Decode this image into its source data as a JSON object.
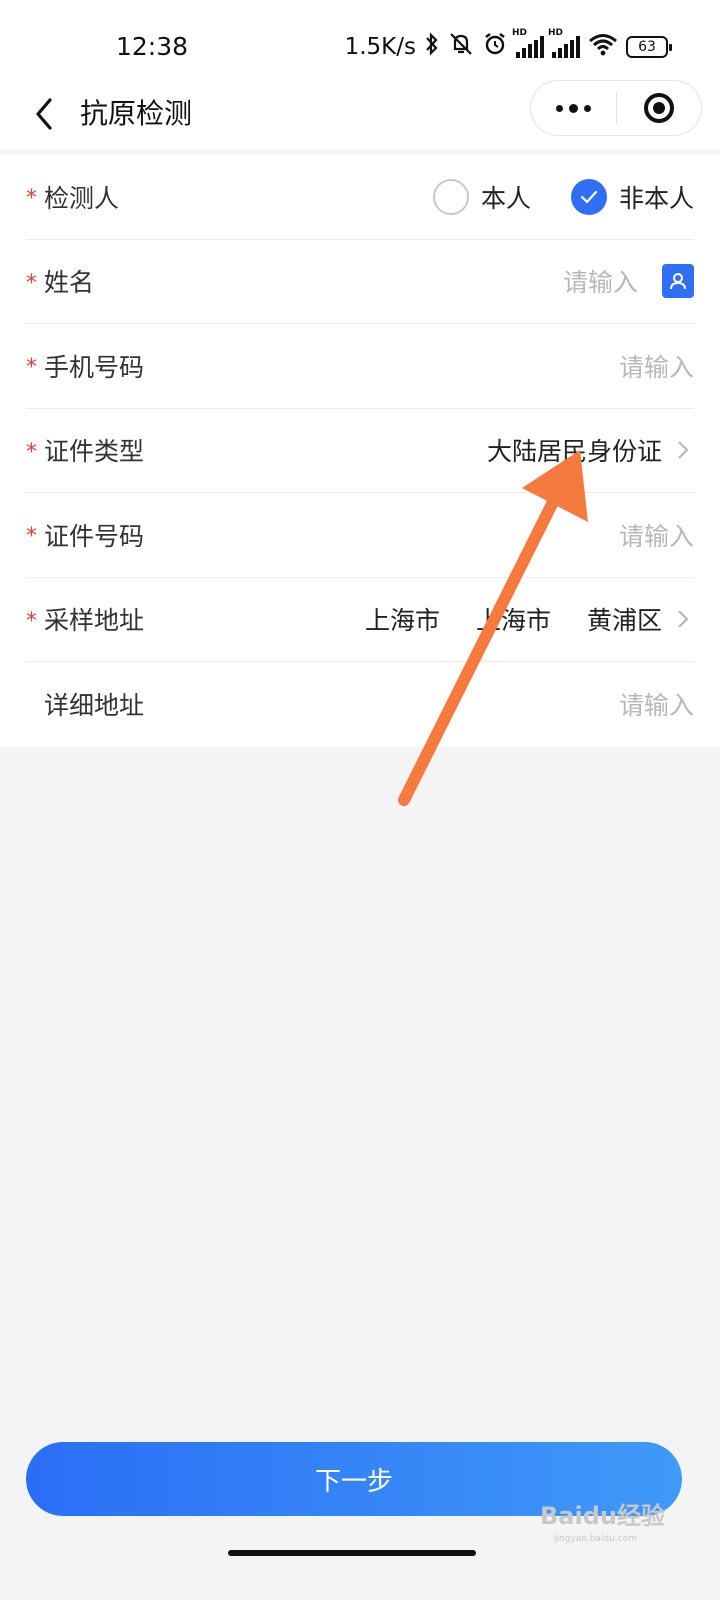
{
  "status_bar": {
    "time": "12:38",
    "speed": "1.5K/s",
    "hd1": "HD",
    "hd2": "HD",
    "battery": "63"
  },
  "nav": {
    "title": "抗原检测"
  },
  "form": {
    "tester": {
      "label": "检测人",
      "option_self": "本人",
      "option_other": "非本人",
      "selected": "非本人"
    },
    "name": {
      "label": "姓名",
      "placeholder": "请输入"
    },
    "phone": {
      "label": "手机号码",
      "placeholder": "请输入"
    },
    "id_type": {
      "label": "证件类型",
      "value": "大陆居民身份证"
    },
    "id_number": {
      "label": "证件号码",
      "placeholder": "请输入"
    },
    "sample_address": {
      "label": "采样地址",
      "province": "上海市",
      "city": "上海市",
      "district": "黄浦区"
    },
    "detail_address": {
      "label": "详细地址",
      "placeholder": "请输入"
    }
  },
  "next_button": "下一步",
  "watermark": {
    "brand": "Baidu经验",
    "url": "jingyan.baidu.com"
  },
  "colors": {
    "accent": "#2f6ff5",
    "required_star": "#e0432f",
    "annotation_arrow": "#f47a3f"
  }
}
